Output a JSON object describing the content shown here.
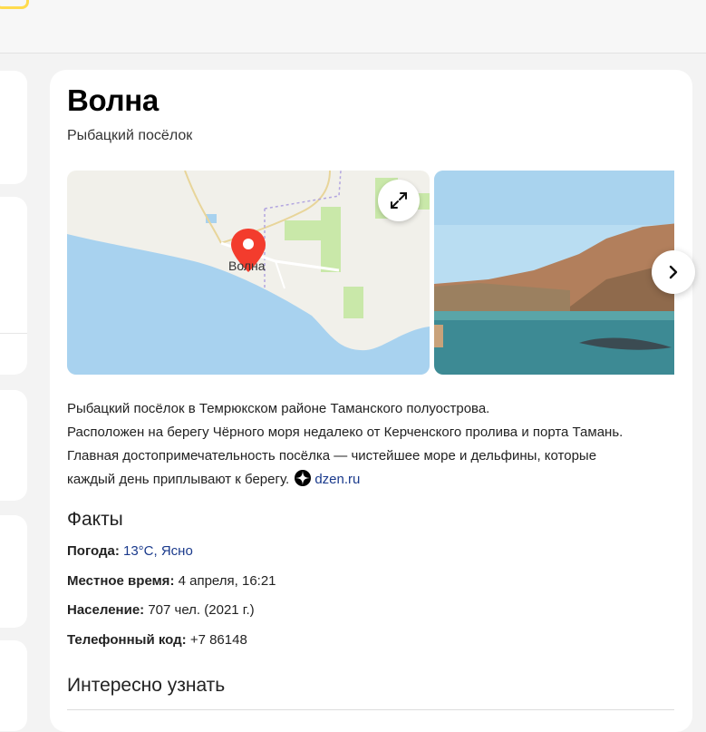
{
  "place": {
    "title": "Волна",
    "subtitle": "Рыбацкий посёлок"
  },
  "map": {
    "label": "Волна",
    "icons": [
      "map-pin-icon",
      "expand-icon"
    ]
  },
  "gallery": {
    "next_icon": "chevron-right-icon"
  },
  "description": {
    "line1": "Рыбацкий посёлок в Темрюкском районе Таманского полуострова.",
    "line2": "Расположен на берегу Чёрного моря недалеко от Керченского пролива и порта Тамань.",
    "line3": "Главная достопримечательность посёлка — чистейшее море и дельфины, которые каждый день приплывают к берегу.",
    "source": "dzen.ru"
  },
  "facts": {
    "title": "Факты",
    "weather_label": "Погода:",
    "weather_value": "13°C, Ясно",
    "time_label": "Местное время:",
    "time_value": "4 апреля, 16:21",
    "population_label": "Население:",
    "population_value": "707 чел. (2021 г.)",
    "phone_label": "Телефонный код:",
    "phone_value": "+7 86148"
  },
  "interesting": {
    "title": "Интересно узнать"
  },
  "colors": {
    "link": "#1a3a8c",
    "pin": "#f33c2d",
    "sea": "#a8d2ef",
    "land": "#f1f0ea",
    "fields": "#c9e8a9"
  }
}
